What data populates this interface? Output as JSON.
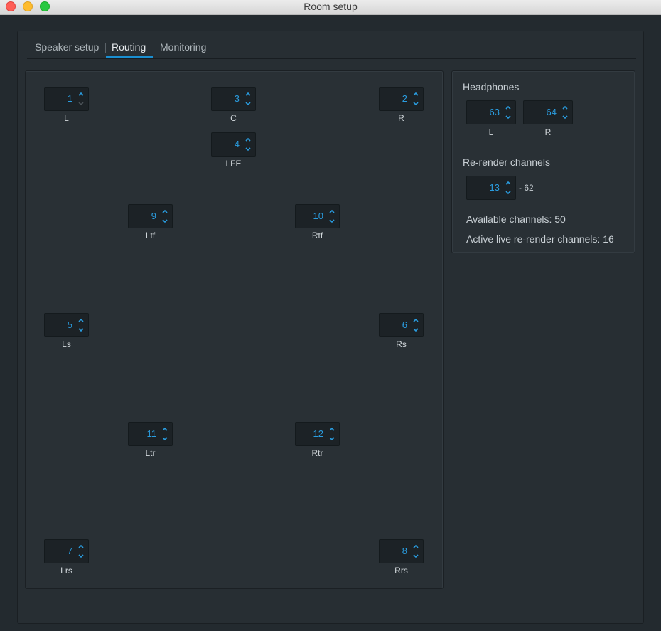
{
  "window": {
    "title": "Room setup"
  },
  "tabs": [
    {
      "label": "Speaker setup"
    },
    {
      "label": "Routing"
    },
    {
      "label": "Monitoring"
    }
  ],
  "speakers": {
    "L": {
      "value": "1",
      "label": "L"
    },
    "C": {
      "value": "3",
      "label": "C"
    },
    "R": {
      "value": "2",
      "label": "R"
    },
    "LFE": {
      "value": "4",
      "label": "LFE"
    },
    "Ltf": {
      "value": "9",
      "label": "Ltf"
    },
    "Rtf": {
      "value": "10",
      "label": "Rtf"
    },
    "Ls": {
      "value": "5",
      "label": "Ls"
    },
    "Rs": {
      "value": "6",
      "label": "Rs"
    },
    "Ltr": {
      "value": "11",
      "label": "Ltr"
    },
    "Rtr": {
      "value": "12",
      "label": "Rtr"
    },
    "Lrs": {
      "value": "7",
      "label": "Lrs"
    },
    "Rrs": {
      "value": "8",
      "label": "Rrs"
    }
  },
  "headphones": {
    "heading": "Headphones",
    "left": {
      "value": "63",
      "label": "L"
    },
    "right": {
      "value": "64",
      "label": "R"
    }
  },
  "rerender": {
    "heading": "Re-render channels",
    "start": "13",
    "end_suffix": "- 62",
    "available": "Available channels: 50",
    "active": "Active live re-render channels: 16"
  },
  "colors": {
    "accent": "#1a8fd1",
    "value": "#2a9de0",
    "background": "#232a2f"
  }
}
